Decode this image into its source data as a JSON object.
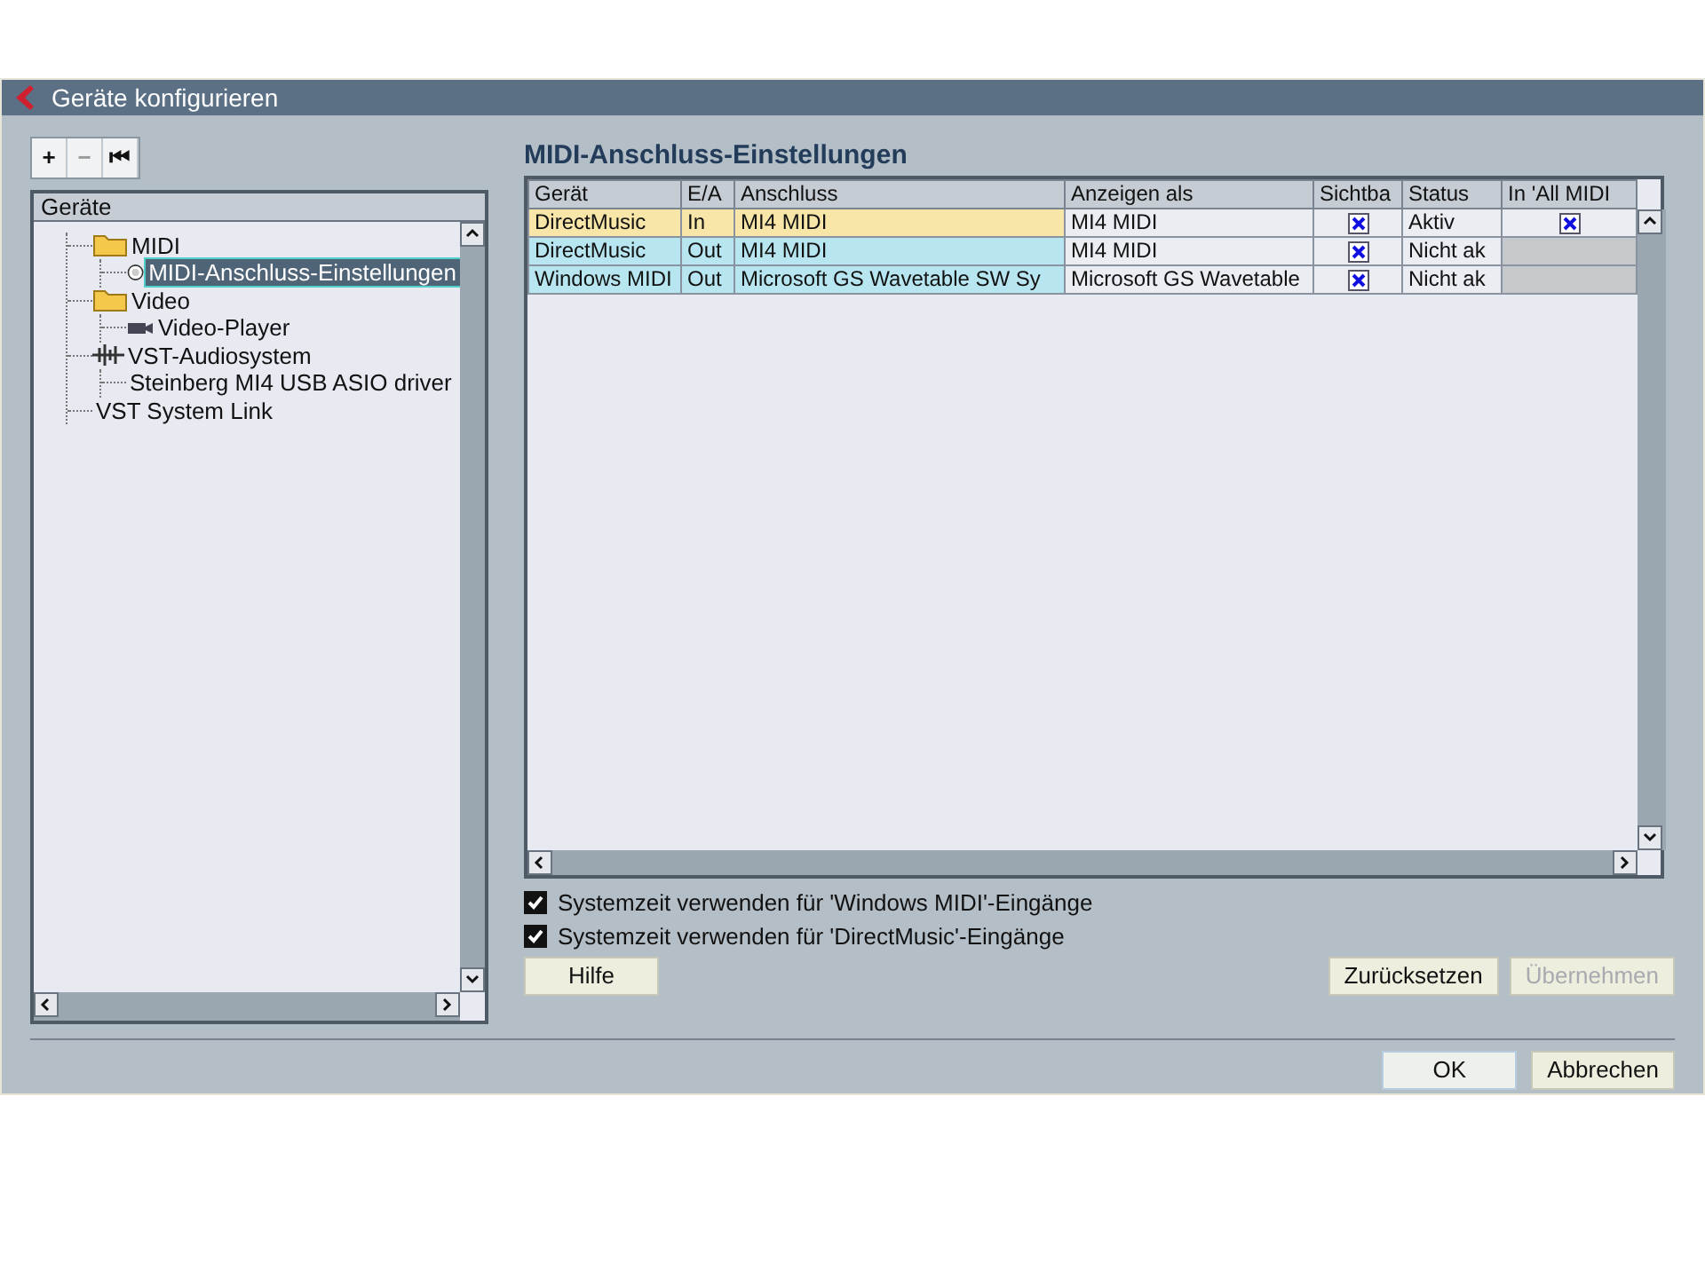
{
  "window": {
    "title": "Geräte konfigurieren"
  },
  "toolbar": [
    "+",
    "−",
    "⏮"
  ],
  "tree": {
    "header": "Geräte",
    "items": [
      {
        "label": "MIDI",
        "kind": "folder",
        "selected": false,
        "children": [
          {
            "label": "MIDI-Anschluss-Einstellungen",
            "kind": "port",
            "selected": true
          }
        ]
      },
      {
        "label": "Video",
        "kind": "folder",
        "selected": false,
        "children": [
          {
            "label": "Video-Player",
            "kind": "video",
            "selected": false
          }
        ]
      },
      {
        "label": "VST-Audiosystem",
        "kind": "audio",
        "selected": false,
        "children": [
          {
            "label": "Steinberg MI4 USB ASIO driver",
            "kind": "none",
            "selected": false
          }
        ]
      },
      {
        "label": "VST System Link",
        "kind": "none",
        "selected": false
      }
    ]
  },
  "panel": {
    "title": "MIDI-Anschluss-Einstellungen",
    "table": {
      "columns": [
        "Gerät",
        "E/A",
        "Anschluss",
        "Anzeigen als",
        "Sichtba",
        "Status",
        "In 'All MIDI"
      ],
      "rows": [
        {
          "device": "DirectMusic",
          "io": "In",
          "port": "MI4 MIDI",
          "show_as": "MI4 MIDI",
          "visible": true,
          "status": "Aktiv",
          "in_all_midi_available": true,
          "in_all_midi": true,
          "color": "#f8e6a8"
        },
        {
          "device": "DirectMusic",
          "io": "Out",
          "port": "MI4 MIDI",
          "show_as": "MI4 MIDI",
          "visible": true,
          "status": "Nicht ak",
          "in_all_midi_available": false,
          "color": "#b8e6f0"
        },
        {
          "device": "Windows MIDI",
          "io": "Out",
          "port": "Microsoft GS Wavetable SW Sy",
          "show_as": "Microsoft GS Wavetable",
          "visible": true,
          "status": "Nicht ak",
          "in_all_midi_available": false,
          "color": "#b8e6f0"
        }
      ]
    },
    "options": [
      {
        "label": "Systemzeit verwenden für 'Windows MIDI'-Eingänge",
        "checked": true
      },
      {
        "label": "Systemzeit verwenden für 'DirectMusic'-Eingänge",
        "checked": true
      }
    ],
    "help_button": "Hilfe",
    "buttons": [
      {
        "label": "Zurücksetzen",
        "disabled": false
      },
      {
        "label": "Übernehmen",
        "disabled": true
      }
    ]
  },
  "footer_buttons": [
    {
      "label": "OK",
      "default": true
    },
    {
      "label": "Abbrechen",
      "default": false
    }
  ]
}
